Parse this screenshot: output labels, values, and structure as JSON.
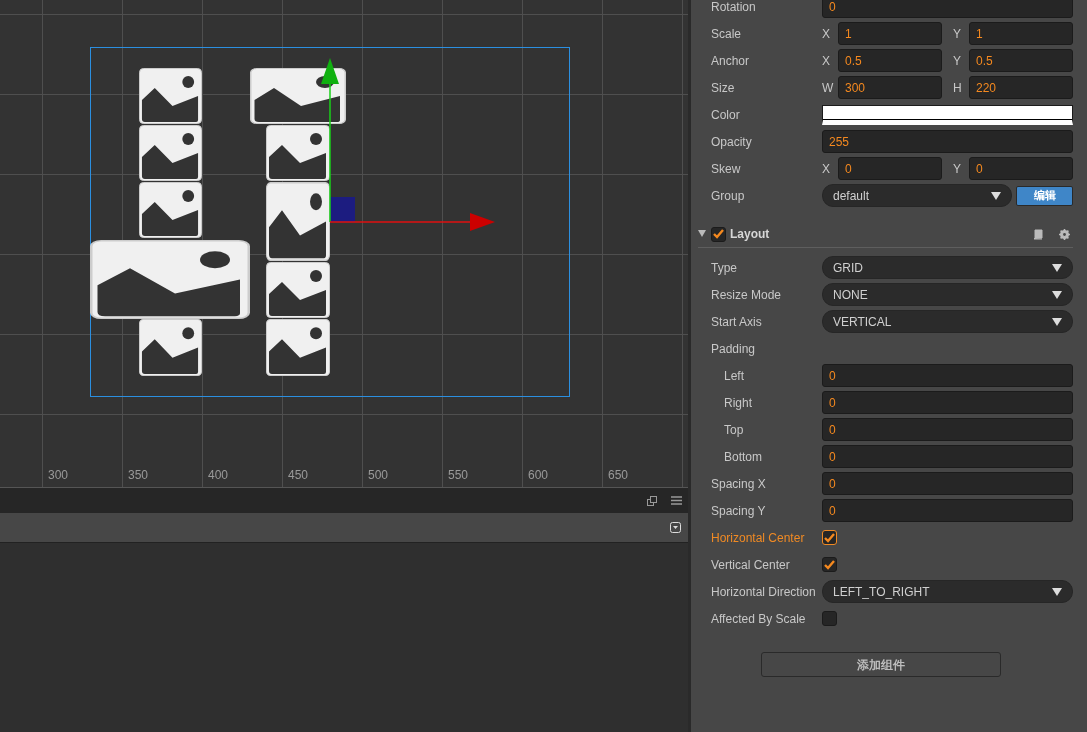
{
  "scene": {
    "ruler": {
      "ticks": [
        "300",
        "350",
        "400",
        "450",
        "500",
        "550",
        "600",
        "650"
      ]
    }
  },
  "inspector": {
    "properties": [
      {
        "kind": "single",
        "label": "Rotation",
        "value": "0"
      },
      {
        "kind": "pair",
        "label": "Scale",
        "fields": [
          {
            "axis": "X",
            "value": "1"
          },
          {
            "axis": "Y",
            "value": "1"
          }
        ]
      },
      {
        "kind": "pair",
        "label": "Anchor",
        "fields": [
          {
            "axis": "X",
            "value": "0.5"
          },
          {
            "axis": "Y",
            "value": "0.5"
          }
        ]
      },
      {
        "kind": "pair",
        "label": "Size",
        "fields": [
          {
            "axis": "W",
            "value": "300"
          },
          {
            "axis": "H",
            "value": "220"
          }
        ]
      },
      {
        "kind": "color",
        "label": "Color",
        "color": "#ffffff"
      },
      {
        "kind": "single",
        "label": "Opacity",
        "value": "255"
      },
      {
        "kind": "pair",
        "label": "Skew",
        "fields": [
          {
            "axis": "X",
            "value": "0"
          },
          {
            "axis": "Y",
            "value": "0"
          }
        ]
      },
      {
        "kind": "select_button",
        "label": "Group",
        "value": "default",
        "button": "编辑"
      }
    ],
    "component": {
      "title": "Layout",
      "enabled": true,
      "expanded": true,
      "properties": [
        {
          "kind": "select",
          "label": "Type",
          "value": "GRID"
        },
        {
          "kind": "select",
          "label": "Resize Mode",
          "value": "NONE"
        },
        {
          "kind": "select",
          "label": "Start Axis",
          "value": "VERTICAL"
        },
        {
          "kind": "group",
          "label": "Padding",
          "children": [
            {
              "kind": "single",
              "label": "Left",
              "value": "0"
            },
            {
              "kind": "single",
              "label": "Right",
              "value": "0"
            },
            {
              "kind": "single",
              "label": "Top",
              "value": "0"
            },
            {
              "kind": "single",
              "label": "Bottom",
              "value": "0"
            }
          ]
        },
        {
          "kind": "single",
          "label": "Spacing X",
          "value": "0"
        },
        {
          "kind": "single",
          "label": "Spacing Y",
          "value": "0"
        },
        {
          "kind": "checkbox",
          "label": "Horizontal Center",
          "checked": true,
          "focused": true
        },
        {
          "kind": "checkbox",
          "label": "Vertical Center",
          "checked": true,
          "focused": false
        },
        {
          "kind": "select",
          "label": "Horizontal Direction",
          "value": "LEFT_TO_RIGHT"
        },
        {
          "kind": "checkbox",
          "label": "Affected By Scale",
          "checked": false,
          "focused": false
        }
      ]
    },
    "add_button": "添加组件"
  }
}
